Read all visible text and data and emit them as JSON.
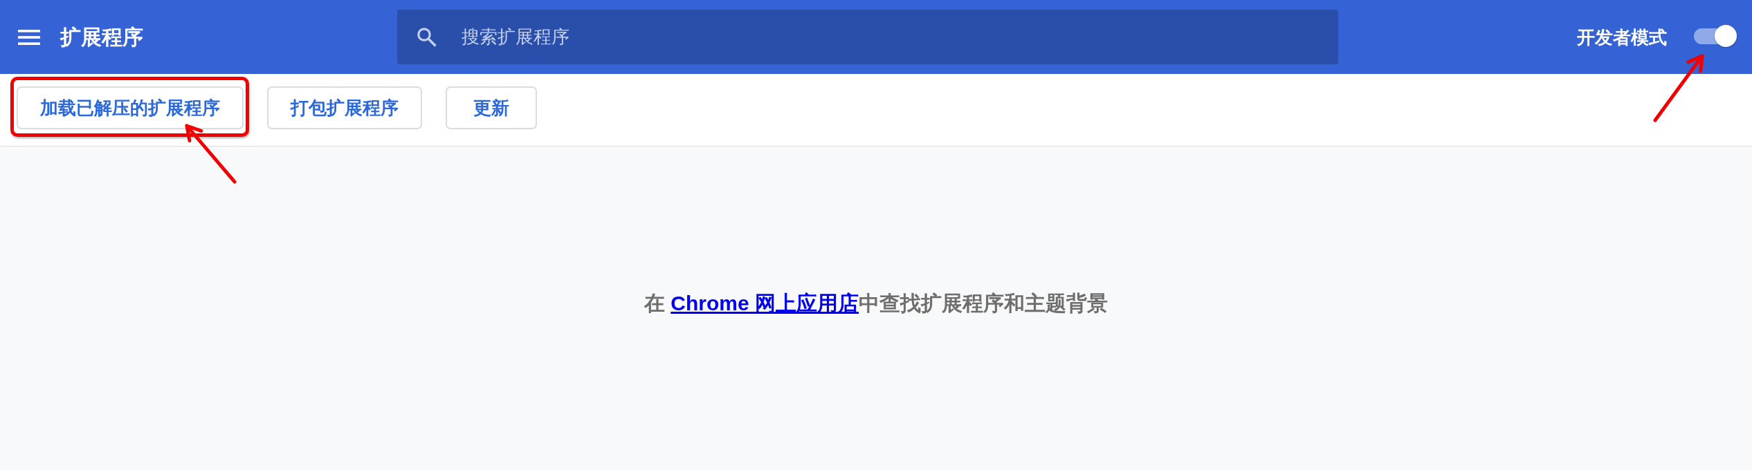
{
  "header": {
    "title": "扩展程序",
    "search": {
      "placeholder": "搜索扩展程序"
    },
    "developer_mode": {
      "label": "开发者模式",
      "on": true,
      "annotated": true
    }
  },
  "toolbar": {
    "buttons": [
      {
        "label": "加载已解压的扩展程序",
        "annotated": true
      },
      {
        "label": "打包扩展程序",
        "annotated": false
      },
      {
        "label": "更新",
        "annotated": false
      }
    ]
  },
  "empty_state": {
    "before": "在 ",
    "link": "Chrome 网上应用店",
    "after": "中查找扩展程序和主题背景"
  }
}
